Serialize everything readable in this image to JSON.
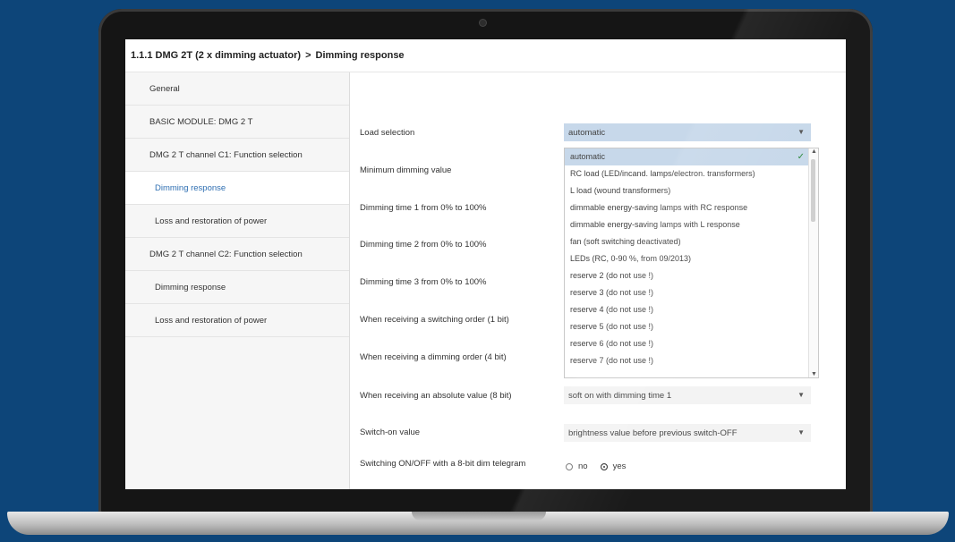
{
  "window": {
    "path": "1.1.1 DMG 2T (2 x dimming actuator)",
    "separator": ">",
    "title": "Dimming response"
  },
  "sidebar": {
    "items": [
      {
        "label": "General"
      },
      {
        "label": "BASIC MODULE: DMG 2 T"
      },
      {
        "label": "DMG 2 T channel C1: Function selection"
      },
      {
        "label": "Dimming response"
      },
      {
        "label": "Loss and restoration of power"
      },
      {
        "label": "DMG 2 T channel C2: Function selection"
      },
      {
        "label": "Dimming response"
      },
      {
        "label": "Loss and restoration of power"
      }
    ]
  },
  "params": {
    "load_selection": {
      "label": "Load selection",
      "value": "automatic"
    },
    "min_dimming": {
      "label": "Minimum dimming value"
    },
    "dim_time_1": {
      "label": "Dimming time 1 from 0% to 100%"
    },
    "dim_time_2": {
      "label": "Dimming time 2 from 0% to 100%"
    },
    "dim_time_3": {
      "label": "Dimming time 3 from 0% to 100%"
    },
    "switching_order": {
      "label": "When receiving a switching order (1 bit)"
    },
    "dimming_order": {
      "label": "When receiving a dimming order (4 bit)"
    },
    "absolute_value": {
      "label": "When receiving an absolute value (8 bit)",
      "value": "soft on with dimming time 1"
    },
    "switch_on_value": {
      "label": "Switch-on value",
      "value": "brightness value before previous switch-OFF"
    },
    "switching_8bit": {
      "label": "Switching ON/OFF with a 8-bit dim telegram",
      "option_no": "no",
      "option_yes": "yes",
      "selected": "yes"
    }
  },
  "dropdown": {
    "options": [
      "automatic",
      "RC load (LED/incand. lamps/electron. transformers)",
      "L load (wound transformers)",
      "dimmable energy-saving lamps with RC response",
      "dimmable energy-saving lamps with L response",
      "fan (soft switching deactivated)",
      "LEDs (RC, 0-90 %, from 09/2013)",
      "reserve 2 (do not use !)",
      "reserve 3 (do not use !)",
      "reserve 4 (do not use !)",
      "reserve 5 (do not use !)",
      "reserve 6 (do not use !)",
      "reserve 7 (do not use !)"
    ],
    "selected": "automatic"
  },
  "icons": {
    "check": "check-icon",
    "dropdown_arrow": "chevron-down-icon"
  },
  "colors": {
    "background": "#0d4579",
    "active_nav": "#2f6fb2",
    "selected_option": "#c7d8ea"
  }
}
